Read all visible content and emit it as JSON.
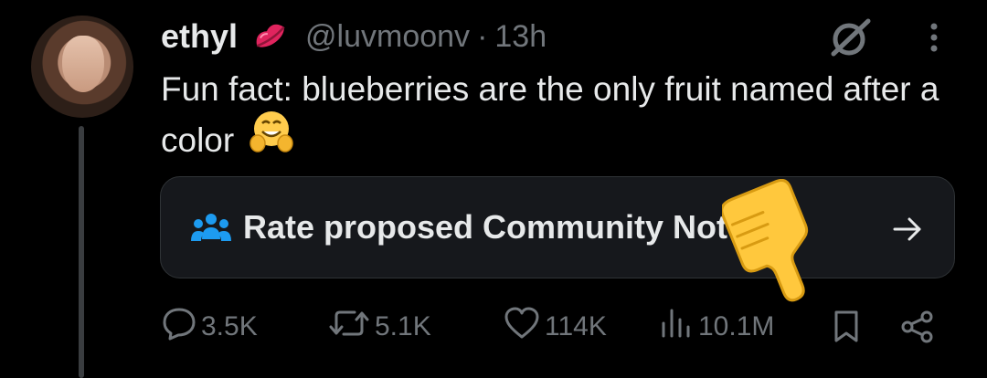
{
  "tweet": {
    "display_name": "ethyl",
    "handle": "@luvmoonv",
    "separator": "·",
    "time": "13h",
    "text": "Fun fact: blueberries are the only fruit named after a color",
    "icons": {
      "name_emoji": "kiss-lips-icon",
      "trailing_emoji": "hugging-face-icon",
      "overlay_emoji": "thumbs-down-icon",
      "grok": "grok-icon",
      "more": "more-options-icon"
    }
  },
  "community_note": {
    "label": "Rate proposed Community Notes",
    "icon": "people-icon",
    "arrow": "arrow-right-icon",
    "accent_color": "#1d9bf0"
  },
  "actions": {
    "replies": "3.5K",
    "reposts": "5.1K",
    "likes": "114K",
    "views": "10.1M",
    "bookmark": "bookmark-icon",
    "share": "share-icon"
  }
}
